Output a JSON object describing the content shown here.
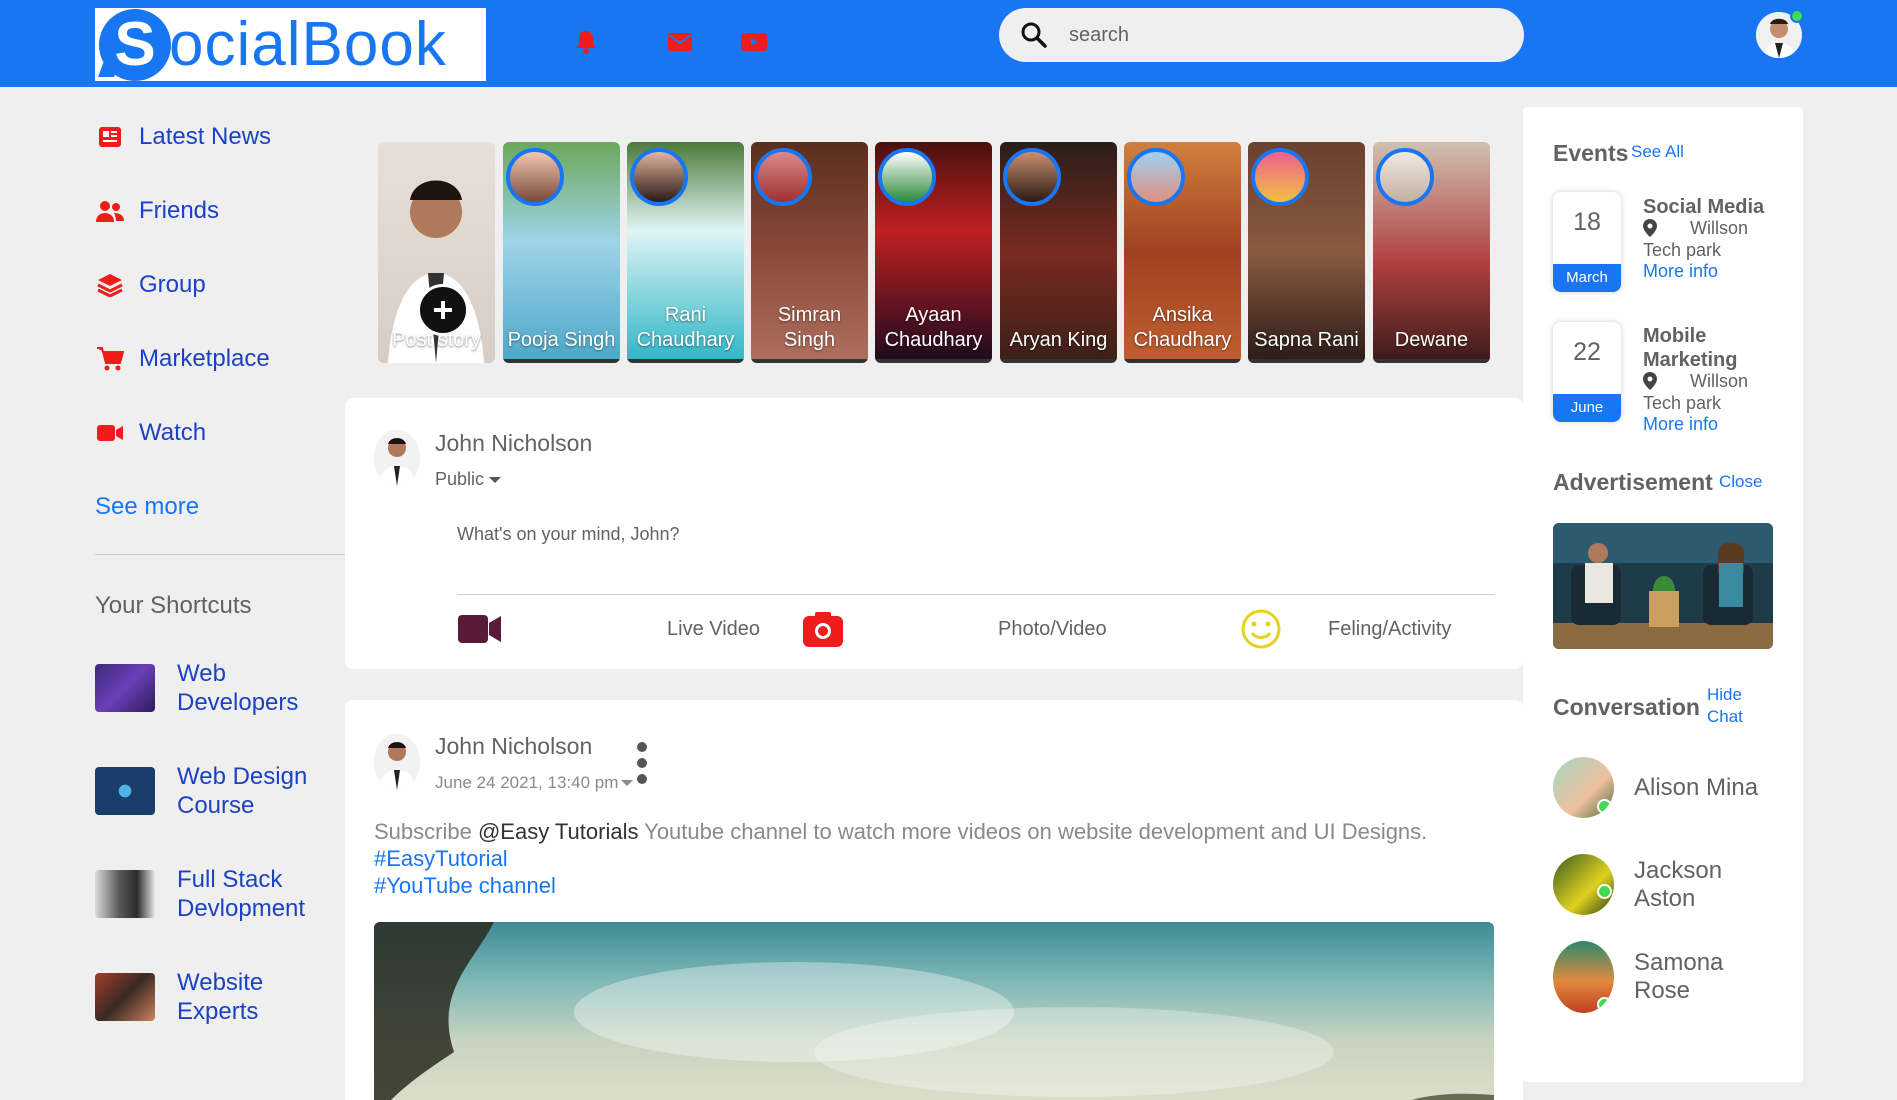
{
  "navbar": {
    "logo_text": "ocialBook",
    "logo_mark": "S",
    "icons": [
      "bell-icon",
      "inbox-icon",
      "video-icon"
    ],
    "search_placeholder": "search",
    "accent_color": "#1876f2"
  },
  "left_sidebar": {
    "links": [
      {
        "label": "Latest News",
        "icon": "news-icon"
      },
      {
        "label": "Friends",
        "icon": "friends-icon"
      },
      {
        "label": "Group",
        "icon": "group-icon"
      },
      {
        "label": "Marketplace",
        "icon": "cart-icon"
      },
      {
        "label": "Watch",
        "icon": "watch-icon"
      }
    ],
    "see_more": "See more",
    "shortcuts_title": "Your Shortcuts",
    "shortcuts": [
      {
        "label": "Web Developers"
      },
      {
        "label": "Web Design Course"
      },
      {
        "label": "Full Stack Devlopment"
      },
      {
        "label": "Website Experts"
      }
    ]
  },
  "stories": [
    {
      "name": "Post story",
      "is_own": true
    },
    {
      "name": "Pooja Singh"
    },
    {
      "name": "Rani Chaudhary"
    },
    {
      "name": "Simran Singh"
    },
    {
      "name": "Ayaan Chaudhary"
    },
    {
      "name": "Aryan King"
    },
    {
      "name": "Ansika Chaudhary"
    },
    {
      "name": "Sapna Rani"
    },
    {
      "name": "Dewane"
    }
  ],
  "create_post": {
    "user_name": "John Nicholson",
    "privacy": "Public",
    "placeholder": "What's on your mind, John?",
    "actions": [
      {
        "label": "Live Video",
        "icon": "video-camera-icon"
      },
      {
        "label": "Photo/Video",
        "icon": "camera-icon"
      },
      {
        "label": "Feling/Activity",
        "icon": "smile-icon"
      }
    ]
  },
  "post": {
    "user_name": "John Nicholson",
    "date": "June 24 2021, 13:40 pm",
    "text_prefix": "Subscribe ",
    "mention": "@Easy Tutorials",
    "text_suffix": " Youtube channel to watch more videos on website development and UI Designs.",
    "hashtags": [
      "#EasyTutorial",
      "#YouTube channel"
    ]
  },
  "right_sidebar": {
    "events_title": "Events",
    "events_link": "See All",
    "events": [
      {
        "day": "18",
        "month": "March",
        "title": "Social Media",
        "loc_line1": "Willson",
        "loc_line2": "Tech park",
        "more": "More info"
      },
      {
        "day": "22",
        "month": "June",
        "title": "Mobile Marketing",
        "loc_line1": "Willson",
        "loc_line2": "Tech park",
        "more": "More info"
      }
    ],
    "ad_title": "Advertisement",
    "ad_link": "Close",
    "conv_title": "Conversation",
    "conv_link_1": "Hide",
    "conv_link_2": "Chat",
    "contacts": [
      {
        "name": "Alison Mina"
      },
      {
        "name": "Jackson Aston"
      },
      {
        "name": "Samona Rose"
      }
    ]
  }
}
